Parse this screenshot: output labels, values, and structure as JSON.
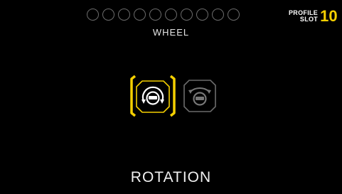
{
  "header": {
    "slot_count": 10,
    "category_label": "WHEEL",
    "profile_label_line1": "PROFILE",
    "profile_label_line2": "SLOT",
    "profile_number": "10"
  },
  "options": [
    {
      "icon": "wheel-rotation-icon",
      "selected": true
    },
    {
      "icon": "wheel-tilt-icon",
      "selected": false
    }
  ],
  "footer": {
    "title": "ROTATION"
  },
  "colors": {
    "accent": "#f5d000",
    "inactive": "#6b6b6b",
    "background": "#000000"
  }
}
